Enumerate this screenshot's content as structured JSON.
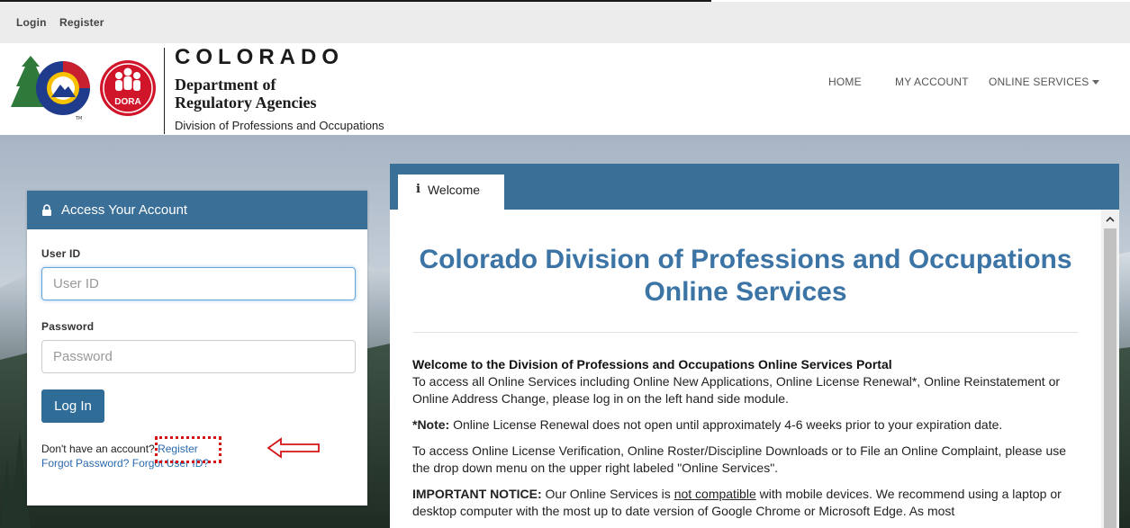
{
  "util_bar": {
    "login": "Login",
    "register": "Register"
  },
  "brand": {
    "state": "COLORADO",
    "dept_line1": "Department of",
    "dept_line2": "Regulatory Agencies",
    "division": "Division of Professions and Occupations",
    "badge": "DORA",
    "tm": "TM"
  },
  "nav": {
    "home": "HOME",
    "account": "MY ACCOUNT",
    "services": "ONLINE SERVICES"
  },
  "login": {
    "header": "Access Your Account",
    "userid_label": "User ID",
    "userid_placeholder": "User ID",
    "password_label": "Password",
    "password_placeholder": "Password",
    "button": "Log In",
    "no_account": "Don't have an account?",
    "register_link": "Register",
    "forgot_password": "Forgot Password?",
    "forgot_userid": "Forgot User ID?"
  },
  "welcome": {
    "tab": "Welcome",
    "title": "Colorado Division of Professions and Occupations Online Services",
    "intro_head": "Welcome to the Division of Professions and Occupations Online Services Portal",
    "intro_text": "To access all Online Services including Online New Applications, Online License Renewal*, Online Reinstatement or Online Address Change, please log in on the left hand side module.",
    "note_label": "*Note:",
    "note_text": "Online License Renewal does not open until approximately 4-6 weeks prior to your expiration date.",
    "verify_text": "To access Online License Verification, Online Roster/Discipline Downloads or to File an Online Complaint, please use the drop down menu on the upper right labeled \"Online Services\".",
    "important_label": "IMPORTANT NOTICE:",
    "important_pre": "Our Online Services is",
    "important_underline": "not compatible",
    "important_post": "with mobile devices. We recommend using a laptop or desktop computer with the most up to date version of Google Chrome or Microsoft Edge. As most"
  },
  "colors": {
    "primary": "#3a6f97",
    "title": "#3b74a5",
    "link": "#2a6aad",
    "highlight": "#d41414"
  }
}
